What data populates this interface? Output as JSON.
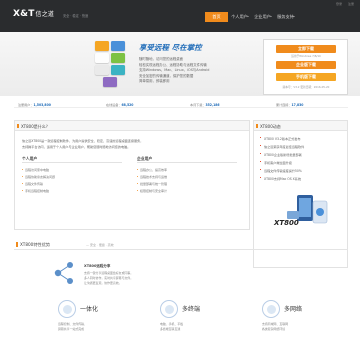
{
  "header": {
    "logo": "X&T",
    "logo_suffix": "信之道",
    "tagline": "安全 · 稳定 · 快速",
    "nav": [
      {
        "label": "首页",
        "active": true
      },
      {
        "label": "个人用户",
        "active": false,
        "dropdown": true
      },
      {
        "label": "企业用户",
        "active": false,
        "dropdown": true
      },
      {
        "label": "服务支持",
        "active": false,
        "dropdown": true
      }
    ],
    "top_links": [
      "登录",
      "注册"
    ]
  },
  "banner": {
    "headline": "享受远程  尽在掌控",
    "lines": [
      "随时随地，访问您的远程桌面",
      "轻松实现远程办公、远程协助与远程文件传输",
      "支持Windows、Mac、Linux、iOS与Android",
      "安全加密的传输通道，保护您的数据",
      "简单易用，即装即用"
    ]
  },
  "download": {
    "buttons": [
      {
        "label": "立即下载",
        "color": "#f08b1c"
      },
      {
        "label": "企业版下载",
        "color": "#f08b1c"
      },
      {
        "label": "手机版下载",
        "color": "#f5a623"
      }
    ],
    "subs": [
      "适用于Windows 7/8/10",
      "版本号：V3.2 更新日期：2016-05-20"
    ]
  },
  "stats": [
    {
      "label": "注册用户",
      "value": "1,503,800"
    },
    {
      "label": "在线设备",
      "value": "68,520"
    },
    {
      "label": "本月下载",
      "value": "352,186"
    },
    {
      "label": "累计连接",
      "value": "17,830"
    }
  ],
  "intro": {
    "title": "XT800是什么？",
    "lines": [
      "信之道XT800是一款远程控制软件，为用户提供安全、稳定、高速的远程桌面连接服务，",
      "支持跨平台访问，适用于个人用户与企业用户，帮助您随时随地访问您的电脑。"
    ],
    "personal": {
      "title": "个人用户",
      "items": [
        "远程访问家中电脑",
        "远程协助亲友解决问题",
        "远程文件传输",
        "手机远程控制电脑"
      ]
    },
    "enterprise": {
      "title": "企业用户",
      "items": [
        "远程办公，提高效率",
        "远程技术支持与运维",
        "批量部署与统一管理",
        "权限控制与安全审计"
      ]
    }
  },
  "news": {
    "title": "XT800动态",
    "items": [
      "XT800 V3.2版本正式发布",
      "信之道荣获年度最佳远程软件",
      "XT800企业版新增批量部署",
      "手机客户端全面升级",
      "远程文件传输速度提升50%",
      "XT800支持Mac OS X系统"
    ],
    "product_label": "XT800"
  },
  "features": {
    "title": "XT800特性优势",
    "subtitle": "— 安全 · 便捷 · 高效",
    "share": {
      "title": "XT800远程分享",
      "lines": [
        "支持一键分享远程桌面给好友或同事，",
        "多人同时协作，实时共享屏幕与文件，",
        "让沟通更直观，协作更高效。"
      ]
    },
    "items": [
      {
        "name": "一体化",
        "lines": [
          "远程控制、文件传输、",
          "屏幕共享一站式完成"
        ]
      },
      {
        "name": "多终端",
        "lines": [
          "电脑、手机、平板",
          "多终端互联互通"
        ]
      },
      {
        "name": "多网络",
        "lines": [
          "支持局域网、互联网",
          "各类复杂网络环境"
        ]
      }
    ]
  }
}
